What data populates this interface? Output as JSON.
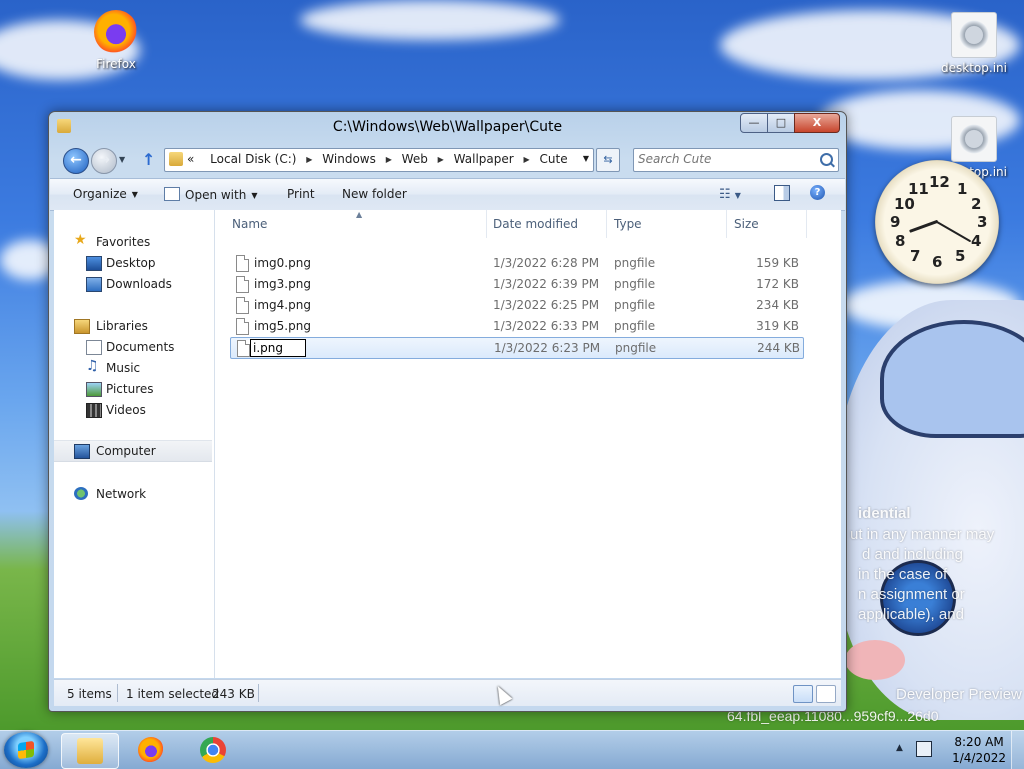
{
  "desktop": {
    "icons": [
      {
        "label": "Firefox"
      },
      {
        "label": "desktop.ini"
      },
      {
        "label": "desktop.ini"
      }
    ],
    "watermark_lines": [
      "idential",
      "ut in any manner may",
      "d and including",
      "in the case of",
      "n assignment or",
      "applicable), and",
      "Developer Preview",
      "64.fbl_eeap.11080...959cf9...26d0"
    ],
    "clock_numbers": [
      "12",
      "1",
      "2",
      "3",
      "4",
      "5",
      "6",
      "7",
      "8",
      "9",
      "10",
      "11"
    ],
    "clock_time": {
      "hour": 8,
      "minute": 20
    }
  },
  "window": {
    "title": "C:\\Windows\\Web\\Wallpaper\\Cute",
    "controls": {
      "minimize": "—",
      "maximize": "□",
      "close": "X"
    },
    "breadcrumb": [
      "Local Disk (C:)",
      "Windows",
      "Web",
      "Wallpaper",
      "Cute"
    ],
    "breadcrumb_prefix": "«",
    "search_placeholder": "Search Cute",
    "toolbar": {
      "organize": "Organize",
      "open_with": "Open with",
      "print": "Print",
      "new_folder": "New folder"
    },
    "nav": {
      "favorites": "Favorites",
      "desktop": "Desktop",
      "downloads": "Downloads",
      "libraries": "Libraries",
      "documents": "Documents",
      "music": "Music",
      "pictures": "Pictures",
      "videos": "Videos",
      "computer": "Computer",
      "network": "Network"
    },
    "columns": {
      "name": "Name",
      "date": "Date modified",
      "type": "Type",
      "size": "Size"
    },
    "files": [
      {
        "name": "img0.png",
        "date": "1/3/2022 6:28 PM",
        "type": "pngfile",
        "size": "159 KB"
      },
      {
        "name": "img3.png",
        "date": "1/3/2022 6:39 PM",
        "type": "pngfile",
        "size": "172 KB"
      },
      {
        "name": "img4.png",
        "date": "1/3/2022 6:25 PM",
        "type": "pngfile",
        "size": "234 KB"
      },
      {
        "name": "img5.png",
        "date": "1/3/2022 6:33 PM",
        "type": "pngfile",
        "size": "319 KB"
      },
      {
        "name": "i.png",
        "date": "1/3/2022 6:23 PM",
        "type": "pngfile",
        "size": "244 KB",
        "renaming": true
      }
    ],
    "status": {
      "count": "5 items",
      "selection": "1 item selected",
      "size": "243 KB"
    }
  },
  "taskbar": {
    "time": "8:20 AM",
    "date": "1/4/2022",
    "tray_arrow": "▲"
  }
}
